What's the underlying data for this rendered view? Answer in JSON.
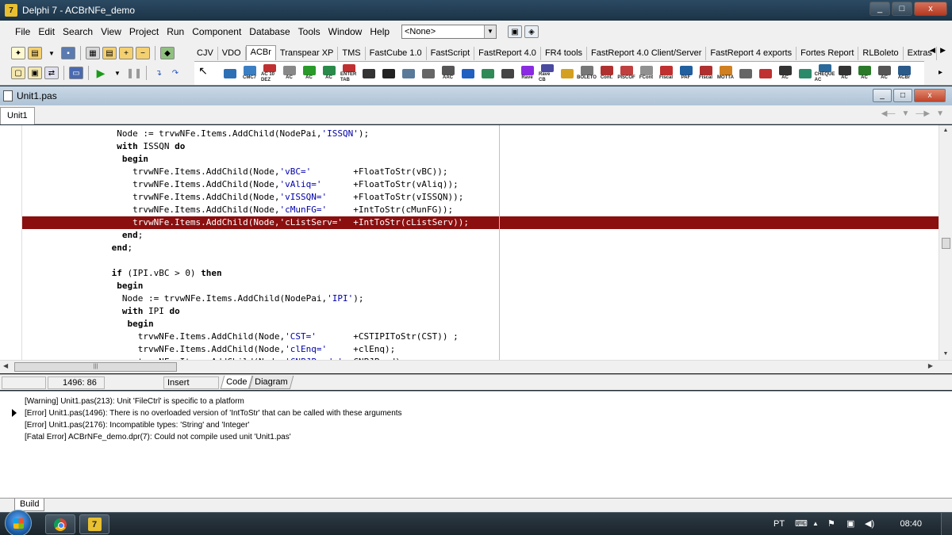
{
  "window": {
    "title": "Delphi 7 - ACBrNFe_demo",
    "app_icon": "7",
    "buttons": [
      "_",
      "□",
      "x"
    ]
  },
  "menu": [
    "File",
    "Edit",
    "Search",
    "View",
    "Project",
    "Run",
    "Component",
    "Database",
    "Tools",
    "Window",
    "Help"
  ],
  "config_select": {
    "value": "<None>"
  },
  "palette_tabs": [
    "CJV",
    "VDO",
    "ACBr",
    "Transpear XP",
    "TMS",
    "FastCube 1.0",
    "FastScript",
    "FastReport 4.0",
    "FR4 tools",
    "FastReport 4.0 Client/Server",
    "FastReport 4 exports",
    "Fortes Report",
    "RLBoleto",
    "Extras"
  ],
  "palette_active": "ACBr",
  "palette_icons": [
    {
      "name": "ACBrCalculadora",
      "label": "",
      "color": "#2d6fb5"
    },
    {
      "name": "ACBrCMC7",
      "label": "CMC7",
      "color": "#3a7fc4"
    },
    {
      "name": "ACBrExtenso",
      "label": "AC 10 DEZ",
      "color": "#c03030"
    },
    {
      "name": "ACBrValidador",
      "label": "AC",
      "color": "#888888"
    },
    {
      "name": "ACBrEnterTab",
      "label": "AC",
      "color": "#2a9a2a"
    },
    {
      "name": "ACBrGIF",
      "label": "AC",
      "color": "#2a8a4a"
    },
    {
      "name": "ACBrEnterTab2",
      "label": "ENTER TAB",
      "color": "#c03030"
    },
    {
      "name": "ACBrDFe",
      "label": "",
      "color": "#333333"
    },
    {
      "name": "ACBrBarCode",
      "label": "",
      "color": "#222222"
    },
    {
      "name": "ACBrIBGE",
      "label": "",
      "color": "#5a7a9a"
    },
    {
      "name": "ACBrMail",
      "label": "",
      "color": "#666666"
    },
    {
      "name": "ACBrAAC",
      "label": "AAC",
      "color": "#555555"
    },
    {
      "name": "ACBrSocket",
      "label": "",
      "color": "#2060c0"
    },
    {
      "name": "ACBrCEP",
      "label": "",
      "color": "#2e8b57"
    },
    {
      "name": "ACBrFeriado",
      "label": "",
      "color": "#444444"
    },
    {
      "name": "ACBrRave",
      "label": "Rave",
      "color": "#8a2be2"
    },
    {
      "name": "ACBrNFeDANFeRave",
      "label": "Rave CB",
      "color": "#4a4aa0"
    },
    {
      "name": "ACBrSpedFiscal",
      "label": "",
      "color": "#d4a020"
    },
    {
      "name": "ACBrBoleto",
      "label": "BOLETO",
      "color": "#777777"
    },
    {
      "name": "ACBrContabil",
      "label": "Cont.",
      "color": "#b03030"
    },
    {
      "name": "ACBrPISCOFINS",
      "label": "PISCOF",
      "color": "#c04040"
    },
    {
      "name": "ACBrFCont",
      "label": "FCont",
      "color": "#909090"
    },
    {
      "name": "ACBrFiscal",
      "label": "Fiscal",
      "color": "#c03030"
    },
    {
      "name": "ACBrPAF",
      "label": "PAF",
      "color": "#2060a0"
    },
    {
      "name": "ACBrSpedFiscal2",
      "label": "Fiscal",
      "color": "#b03030"
    },
    {
      "name": "ACBrCTe",
      "label": "MOTTA",
      "color": "#d08020"
    },
    {
      "name": "ACBrNFSe",
      "label": "",
      "color": "#666666"
    },
    {
      "name": "ACBrNFe",
      "label": "",
      "color": "#c03030"
    },
    {
      "name": "ACBrDevice",
      "label": "AC",
      "color": "#333333"
    },
    {
      "name": "ACBrECF",
      "label": "",
      "color": "#2a8a6a"
    },
    {
      "name": "ACBrCHQ",
      "label": "CHEQUE AC",
      "color": "#2a6a9a"
    },
    {
      "name": "ACBrLCB",
      "label": "AC",
      "color": "#333333"
    },
    {
      "name": "ACBrTER",
      "label": "AC",
      "color": "#2a7a2a"
    },
    {
      "name": "ACBrDIS",
      "label": "AC",
      "color": "#555555"
    },
    {
      "name": "ACBrBAL",
      "label": "ACBr",
      "color": "#2a5a8a"
    }
  ],
  "editor": {
    "title": "Unit1.pas",
    "tab": "Unit1",
    "code_lines": [
      [
        {
          "t": "                  Node := trvwNFe.Items.AddChild(NodePai,"
        },
        {
          "t": "'ISSQN'",
          "c": "str"
        },
        {
          "t": ");"
        }
      ],
      [
        {
          "t": "                  "
        },
        {
          "t": "with",
          "c": "kw"
        },
        {
          "t": " ISSQN "
        },
        {
          "t": "do",
          "c": "kw"
        }
      ],
      [
        {
          "t": "                   "
        },
        {
          "t": "begin",
          "c": "kw"
        }
      ],
      [
        {
          "t": "                     trvwNFe.Items.AddChild(Node,"
        },
        {
          "t": "'vBC='",
          "c": "str"
        },
        {
          "t": "        +FloatToStr(vBC));"
        }
      ],
      [
        {
          "t": "                     trvwNFe.Items.AddChild(Node,"
        },
        {
          "t": "'vAliq='",
          "c": "str"
        },
        {
          "t": "      +FloatToStr(vAliq));"
        }
      ],
      [
        {
          "t": "                     trvwNFe.Items.AddChild(Node,"
        },
        {
          "t": "'vISSQN='",
          "c": "str"
        },
        {
          "t": "     +FloatToStr(vISSQN));"
        }
      ],
      [
        {
          "t": "                     trvwNFe.Items.AddChild(Node,"
        },
        {
          "t": "'cMunFG='",
          "c": "str"
        },
        {
          "t": "     +IntToStr(cMunFG));"
        }
      ],
      [
        {
          "t": "                     trvwNFe.Items.AddChild(Node,"
        },
        {
          "t": "'cListServ='",
          "c": "str"
        },
        {
          "t": "  +IntToStr(cListServ));"
        }
      ],
      [
        {
          "t": "                   "
        },
        {
          "t": "end",
          "c": "kw"
        },
        {
          "t": ";"
        }
      ],
      [
        {
          "t": "                 "
        },
        {
          "t": "end",
          "c": "kw"
        },
        {
          "t": ";"
        }
      ],
      [
        {
          "t": ""
        }
      ],
      [
        {
          "t": "                 "
        },
        {
          "t": "if",
          "c": "kw"
        },
        {
          "t": " (IPI.vBC > 0) "
        },
        {
          "t": "then",
          "c": "kw"
        }
      ],
      [
        {
          "t": "                  "
        },
        {
          "t": "begin",
          "c": "kw"
        }
      ],
      [
        {
          "t": "                   Node := trvwNFe.Items.AddChild(NodePai,"
        },
        {
          "t": "'IPI'",
          "c": "str"
        },
        {
          "t": ");"
        }
      ],
      [
        {
          "t": "                   "
        },
        {
          "t": "with",
          "c": "kw"
        },
        {
          "t": " IPI "
        },
        {
          "t": "do",
          "c": "kw"
        }
      ],
      [
        {
          "t": "                    "
        },
        {
          "t": "begin",
          "c": "kw"
        }
      ],
      [
        {
          "t": "                      trvwNFe.Items.AddChild(Node,"
        },
        {
          "t": "'CST='",
          "c": "str"
        },
        {
          "t": "       +CSTIPIToStr(CST)) ;"
        }
      ],
      [
        {
          "t": "                      trvwNFe.Items.AddChild(Node,"
        },
        {
          "t": "'clEnq='",
          "c": "str"
        },
        {
          "t": "     +clEnq);"
        }
      ],
      [
        {
          "t": "                      trvwNFe.Items.AddChild(Node,"
        },
        {
          "t": "'CNPJProd='",
          "c": "str"
        },
        {
          "t": " +CNPJProd);"
        }
      ]
    ],
    "highlight_line": 7
  },
  "status": {
    "position": "1496:  86",
    "mode": "Insert",
    "view_tabs": [
      "Code",
      "Diagram"
    ]
  },
  "messages": [
    "[Warning] Unit1.pas(213): Unit 'FileCtrl' is specific to a platform",
    "[Error] Unit1.pas(1496): There is no overloaded version of 'IntToStr' that can be called with these arguments",
    "[Error] Unit1.pas(2176): Incompatible types: 'String' and 'Integer'",
    "[Fatal Error] ACBrNFe_demo.dpr(7): Could not compile used unit 'Unit1.pas'"
  ],
  "messages_tab": "Build",
  "taskbar": {
    "language": "PT",
    "clock": "08:40"
  }
}
